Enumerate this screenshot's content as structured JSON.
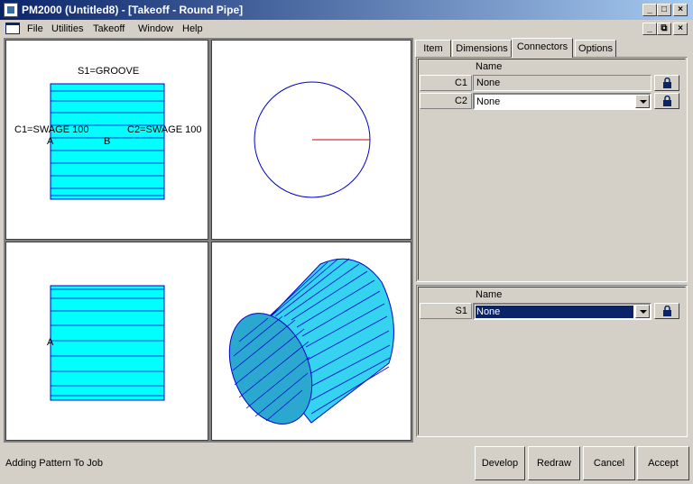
{
  "window": {
    "title": "PM2000 (Untitled8) - [Takeoff - Round Pipe]",
    "controls": {
      "minimize": "_",
      "maximize": "□",
      "close": "×",
      "restore": "⧉"
    }
  },
  "menu": {
    "items": [
      {
        "label": "File",
        "key": "F"
      },
      {
        "label": "Utilities",
        "key": "U"
      },
      {
        "label": "Takeoff",
        "key": "T"
      },
      {
        "label": "Window",
        "key": "W"
      },
      {
        "label": "Help",
        "key": "H"
      }
    ]
  },
  "views": {
    "front": {
      "s1_label": "S1=GROOVE",
      "c1_label": "C1=SWAGE 100",
      "c2_label": "C2=SWAGE 100",
      "point_a": "A",
      "point_b": "B"
    },
    "side": {
      "point_a": "A"
    }
  },
  "colors": {
    "pipe_fill": "#00ffff",
    "pipe_fill_3d": "#35d3f0",
    "pipe_end_3d": "#2aa8d0",
    "pipe_line": "#0000cc",
    "radius_line": "#cc0000",
    "selection": "#0a246a"
  },
  "tabs": [
    {
      "label": "Item",
      "active": false
    },
    {
      "label": "Dimensions",
      "active": false
    },
    {
      "label": "Connectors",
      "active": true
    },
    {
      "label": "Options",
      "active": false
    }
  ],
  "connectors": {
    "header": "Name",
    "rows": [
      {
        "id": "C1",
        "value": "None",
        "type": "static"
      },
      {
        "id": "C2",
        "value": "None",
        "type": "combo"
      }
    ]
  },
  "seams": {
    "header": "Name",
    "rows": [
      {
        "id": "S1",
        "value": "None",
        "type": "combo-selected"
      }
    ]
  },
  "status": {
    "text": "Adding Pattern To Job"
  },
  "buttons": {
    "develop": "Develop",
    "redraw": "Redraw",
    "cancel": "Cancel",
    "accept": "Accept"
  }
}
